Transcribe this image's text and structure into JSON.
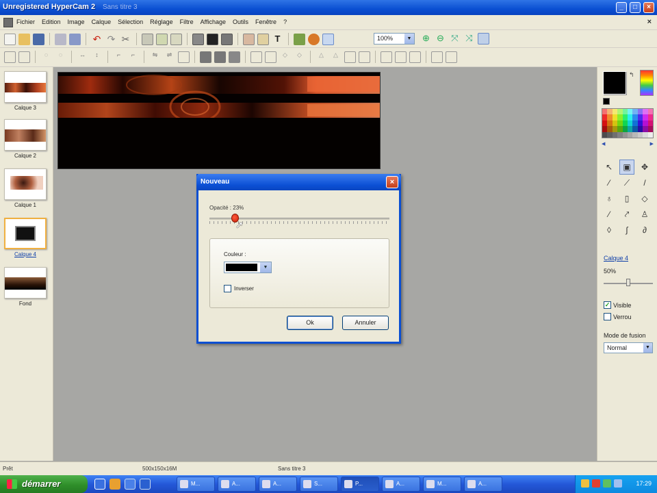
{
  "window": {
    "app_title": "Unregistered HyperCam 2",
    "doc_title": "Sans titre 3"
  },
  "menu": {
    "items": [
      "Fichier",
      "Edition",
      "Image",
      "Calque",
      "Sélection",
      "Réglage",
      "Filtre",
      "Affichage",
      "Outils",
      "Fenêtre",
      "?"
    ]
  },
  "toolbar": {
    "zoom_value": "100%"
  },
  "layers": {
    "items": [
      {
        "label": "Calque 3"
      },
      {
        "label": "Calque 2"
      },
      {
        "label": "Calque 1"
      },
      {
        "label": "Calque 4",
        "selected": true
      },
      {
        "label": "Fond"
      }
    ]
  },
  "dialog": {
    "title": "Nouveau",
    "opacity_label": "Opacité : 23%",
    "opacity_value": 23,
    "color_label": "Couleur :",
    "color_value": "#000000",
    "invert_label": "Inverser",
    "invert_checked": false,
    "ok_label": "Ok",
    "cancel_label": "Annuler"
  },
  "right_panel": {
    "foreground_color": "#000000",
    "layer_name": "Calque 4",
    "layer_opacity_label": "50%",
    "layer_opacity_value": 50,
    "visible_label": "Visible",
    "visible_checked": true,
    "locked_label": "Verrou",
    "locked_checked": false,
    "blend_mode_label": "Mode de fusion",
    "blend_mode_value": "Normal"
  },
  "status": {
    "left": "Prêt",
    "size": "500x150x16M",
    "doc": "Sans titre 3"
  },
  "taskbar": {
    "start_label": "démarrer",
    "clock": "17:29",
    "tasks": [
      {
        "label": "M..."
      },
      {
        "label": "A..."
      },
      {
        "label": "A..."
      },
      {
        "label": "S..."
      },
      {
        "label": "P...",
        "active": true
      },
      {
        "label": "A..."
      },
      {
        "label": "M..."
      },
      {
        "label": "A..."
      }
    ]
  },
  "colors": {
    "xp_blue": "#0a4fd2",
    "face": "#ece9d8",
    "workspace": "#a7a7a4",
    "accent_red": "#e0301a"
  }
}
